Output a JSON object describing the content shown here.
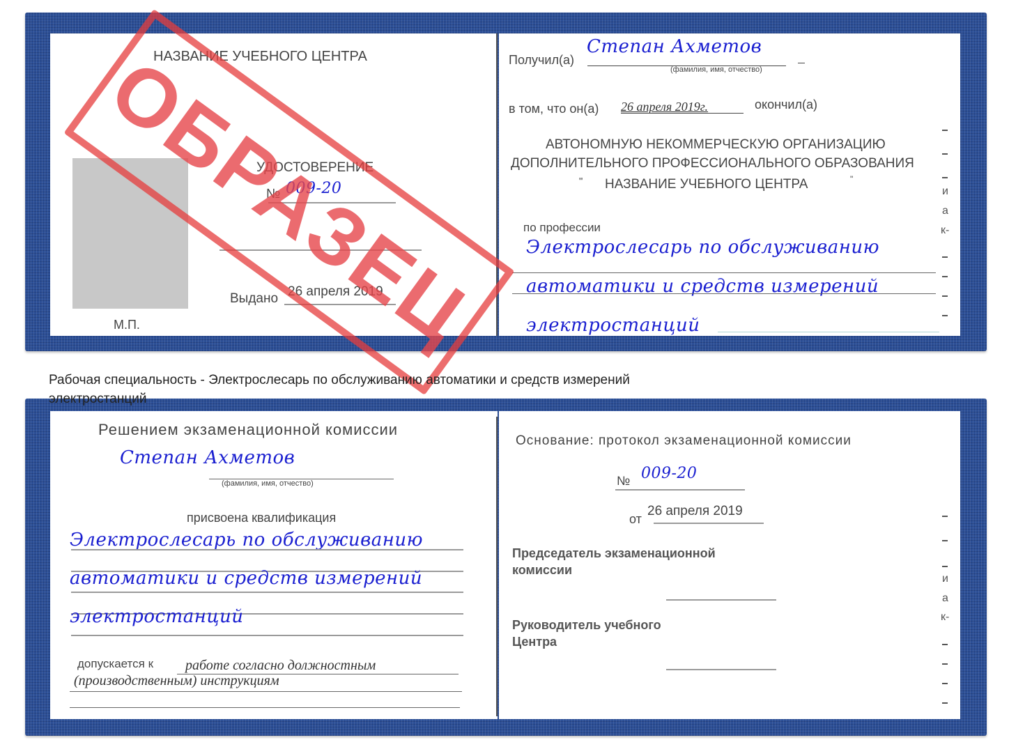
{
  "top_spread": {
    "left_page": {
      "center_name": "НАЗВАНИЕ УЧЕБНОГО ЦЕНТРА",
      "doc_title": "УДОСТОВЕРЕНИЕ",
      "number_label": "№",
      "number_value": "009-20",
      "issued_label": "Выдано",
      "issued_date": "26 апреля 2019",
      "stamp_place": "М.П.",
      "photo_placeholder_color": "#c8c8c8"
    },
    "right_page": {
      "received_label": "Получил(а)",
      "recipient_name": "Степан Ахметов",
      "name_hint": "(фамилия, имя, отчество)",
      "completed_prefix": "в том, что он(а)",
      "completed_date": "26 апреля 2019г.",
      "completed_suffix": "окончил(а)",
      "org_line1": "АВТОНОМНУЮ НЕКОММЕРЧЕСКУЮ ОРГАНИЗАЦИЮ",
      "org_line2": "ДОПОЛНИТЕЛЬНОГО ПРОФЕССИОНАЛЬНОГО ОБРАЗОВАНИЯ",
      "org_quote_open": "\"",
      "org_line3": "НАЗВАНИЕ УЧЕБНОГО ЦЕНТРА",
      "org_quote_close": "\"",
      "profession_label": "по профессии",
      "profession_lines": [
        "Электрослесарь по обслуживанию",
        "автоматики и средств измерений",
        "электростанций"
      ],
      "edge_letters": [
        "и",
        "а",
        "к-"
      ]
    }
  },
  "stamp": {
    "text": "ОБРАЗЕЦ",
    "color": "#e6464b"
  },
  "caption": {
    "line1": "Рабочая специальность - Электрослесарь по обслуживанию автоматики и средств измерений",
    "line2": "электростанций"
  },
  "bottom_spread": {
    "left_page": {
      "decision_title": "Решением экзаменационной комиссии",
      "person_name": "Степан Ахметов",
      "name_hint": "(фамилия, имя, отчество)",
      "qualification_label": "присвоена квалификация",
      "qualification_lines": [
        "Электрослесарь по обслуживанию",
        "автоматики и средств измерений",
        "электростанций"
      ],
      "admitted_label": "допускается к",
      "admitted_line1": "работе согласно должностным",
      "admitted_line2": "(производственным) инструкциям"
    },
    "right_page": {
      "basis_title": "Основание: протокол экзаменационной комиссии",
      "protocol_number_label": "№",
      "protocol_number": "009-20",
      "date_label": "от",
      "protocol_date": "26 апреля 2019",
      "chairman_line1": "Председатель экзаменационной",
      "chairman_line2": "комиссии",
      "head_line1": "Руководитель учебного",
      "head_line2": "Центра",
      "edge_letters": [
        "и",
        "а",
        "к-"
      ]
    }
  },
  "colors": {
    "cover_blue": "#2c4f96",
    "handwriting_blue": "#1a1fd0"
  }
}
